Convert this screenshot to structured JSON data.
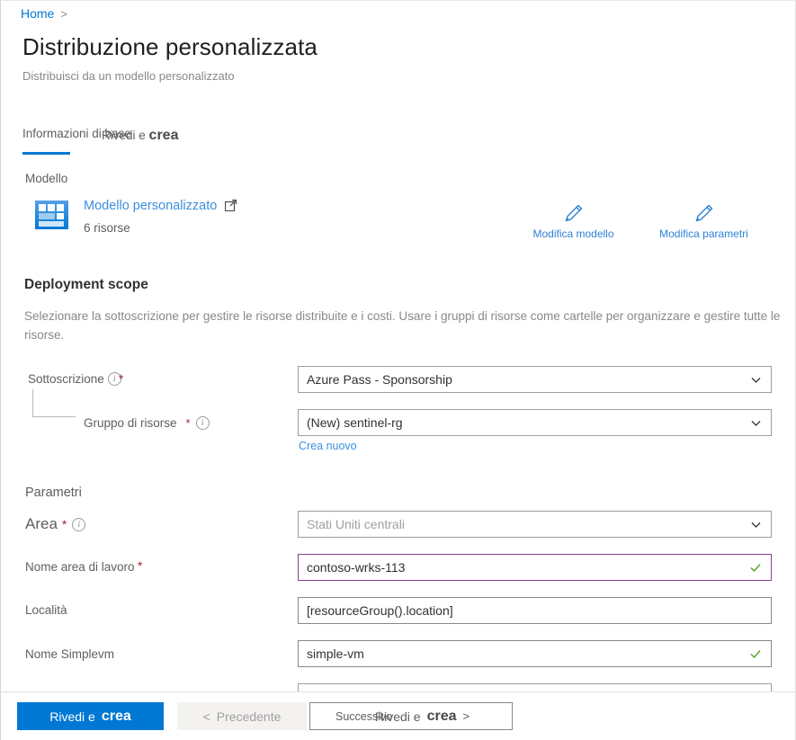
{
  "breadcrumb": {
    "home_label": "Home",
    "separator": ">"
  },
  "header": {
    "title": "Distribuzione personalizzata",
    "subtitle": "Distribuisci da un modello personalizzato"
  },
  "tabs": [
    {
      "label": "Informazioni di base",
      "selected": true
    },
    {
      "label_prefix": "Rivedi e",
      "label_bold": "crea",
      "selected": false
    }
  ],
  "template_section": {
    "label": "Modello",
    "link_text": "Modello personalizzato",
    "external_link_icon": "external-link-icon",
    "resource_count": "6 risorse",
    "icon": "template-grid-icon",
    "actions": [
      {
        "icon": "pencil-icon",
        "label": "Modifica modello"
      },
      {
        "icon": "pencil-icon",
        "label": "Modifica parametri"
      }
    ]
  },
  "deployment_scope": {
    "heading": "Deployment scope",
    "description": "Selezionare la sottoscrizione per gestire le risorse distribuite e i costi. Usare i gruppi di risorse come cartelle per organizzare e gestire tutte le risorse.",
    "fields": [
      {
        "label": "Sottoscrizione",
        "required_marker": "*",
        "info_icon": "info-icon",
        "value": "Azure Pass - Sponsorship",
        "control": "dropdown"
      },
      {
        "label": "Gruppo di risorse",
        "required_marker": "*",
        "info_icon": "info-icon",
        "value": "(New) sentinel-rg",
        "control": "dropdown",
        "helper_link": "Crea nuovo"
      }
    ]
  },
  "parameters": {
    "heading": "Parametri",
    "fields": [
      {
        "label": "Area",
        "required_marker": "*",
        "info_icon": "info-icon",
        "value": "Stati Uniti centrali",
        "control": "dropdown",
        "muted": true
      },
      {
        "label": "Nome area di lavoro",
        "required_marker": "*",
        "value": "contoso-wrks-113",
        "control": "text",
        "validated": true
      },
      {
        "label": "Località",
        "value": "[resourceGroup().location]",
        "control": "text"
      },
      {
        "label": "Nome Simplevm",
        "value": "simple-vm",
        "control": "text",
        "validated": true
      }
    ]
  },
  "footer": {
    "primary": {
      "prefix": "Rivedi e",
      "bold": "crea"
    },
    "previous": {
      "arrow": "<",
      "label": "Precedente"
    },
    "next": {
      "overlay_label": "Successivo",
      "prefix": "Rivedi e",
      "bold": "crea",
      "arrow": ">"
    }
  },
  "colors": {
    "accent": "#0078d4",
    "link": "#3b8fdd",
    "required": "#a4262c",
    "valid_border": "#8a3d92",
    "valid_check": "#5aa82e",
    "muted_text": "#8a8886"
  }
}
